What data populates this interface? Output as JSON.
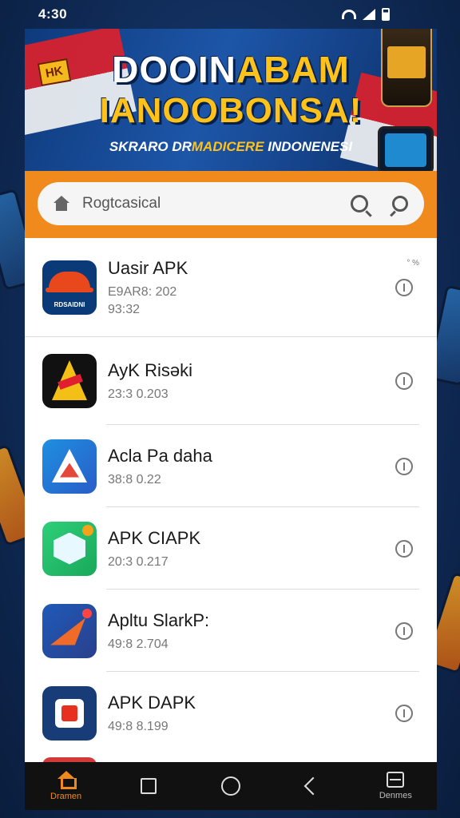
{
  "status_bar": {
    "time": "4:30"
  },
  "banner": {
    "badge": "HK",
    "line1_part1": "DOOIN",
    "line1_part2": "ABAM",
    "line2": "IANOOBONSA!",
    "line3_part1": "SKRARO DR",
    "line3_part2": "MADICERE",
    "line3_part3": " INDONENESI"
  },
  "search": {
    "placeholder": "Rogtcasical"
  },
  "apps": [
    {
      "title": "Uasir APK",
      "meta": "E9AR8: 202",
      "meta2": "93:32",
      "icon": "hat-icon",
      "icon_label": "RDSAIDNI",
      "corner": "° %"
    },
    {
      "title": "AyK Risəki",
      "meta": "23:3 0.203",
      "icon": "a-letter-icon"
    },
    {
      "title": "Acla Pa daha",
      "meta": "38:8 0.22",
      "icon": "triangle-icon"
    },
    {
      "title": "APK CIAPK",
      "meta": "20:3 0.217",
      "icon": "hexagon-icon"
    },
    {
      "title": "Apltu SlarkP:",
      "meta": "49:8 2.704",
      "icon": "arrow-icon"
    },
    {
      "title": "APK DAPK",
      "meta": "49:8 8.199",
      "icon": "badge-icon"
    }
  ],
  "nav": {
    "home_label": "Dramen",
    "menu_label": "Denmes"
  },
  "colors": {
    "accent": "#f08a1c",
    "banner_bg": "#1d56a8"
  }
}
